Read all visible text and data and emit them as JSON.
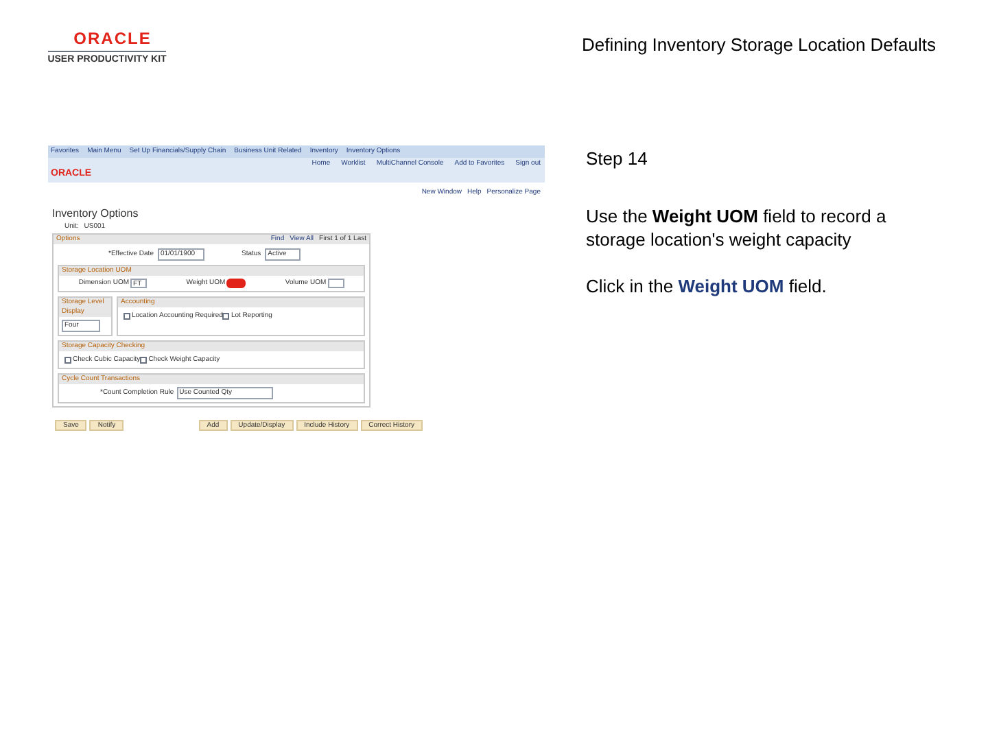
{
  "logo": {
    "brand": "ORACLE",
    "product": "USER PRODUCTIVITY KIT"
  },
  "title": "Defining Inventory Storage Location Defaults",
  "screenshot": {
    "breadcrumbs": [
      "Favorites",
      "Main Menu",
      "Set Up Financials/Supply Chain",
      "Business Unit Related",
      "Inventory",
      "Inventory Options"
    ],
    "brand": "ORACLE",
    "header_links": [
      "Home",
      "Worklist",
      "MultiChannel Console",
      "Add to Favorites",
      "Sign out"
    ],
    "page_links": [
      "New Window",
      "Help",
      "Personalize Page"
    ],
    "page_title": "Inventory Options",
    "unit_label": "Unit:",
    "unit_value": "US001",
    "options_title": "Options",
    "options_nav": [
      "Find",
      "View All"
    ],
    "options_count": "First 1 of 1 Last",
    "effective_date_label": "*Effective Date",
    "effective_date": "01/01/1900",
    "status_label": "Status",
    "status": "Active",
    "uom_title": "Storage Location UOM",
    "uom_fields": [
      {
        "label": "Dimension UOM",
        "value": "FT",
        "highlighted": false
      },
      {
        "label": "Weight UOM",
        "highlighted": true
      },
      {
        "label": "Volume UOM",
        "highlighted": false
      }
    ],
    "level_title": "Storage Level Display",
    "level_value": "Four",
    "accounting_title": "Accounting",
    "accounting_checks": [
      {
        "label": "Location Accounting Required",
        "checked": false
      },
      {
        "label": "Lot Reporting",
        "checked": false
      }
    ],
    "capacity_title": "Storage Capacity Checking",
    "capacity_checks": [
      {
        "label": "Check Cubic Capacity",
        "checked": false
      },
      {
        "label": "Check Weight Capacity",
        "checked": false
      }
    ],
    "cycle_title": "Cycle Count Transactions",
    "count_rule_label": "*Count Completion Rule",
    "count_rule_value": "Use Counted Qty",
    "left_buttons": [
      "Save",
      "Notify"
    ],
    "right_buttons": [
      "Add",
      "Update/Display",
      "Include History",
      "Correct History"
    ]
  },
  "step": {
    "label": "Step 14",
    "instruction": "Use the **Weight UOM** field to record a storage location's weight capacity",
    "action": "Click in the **Weight UOM** field."
  }
}
